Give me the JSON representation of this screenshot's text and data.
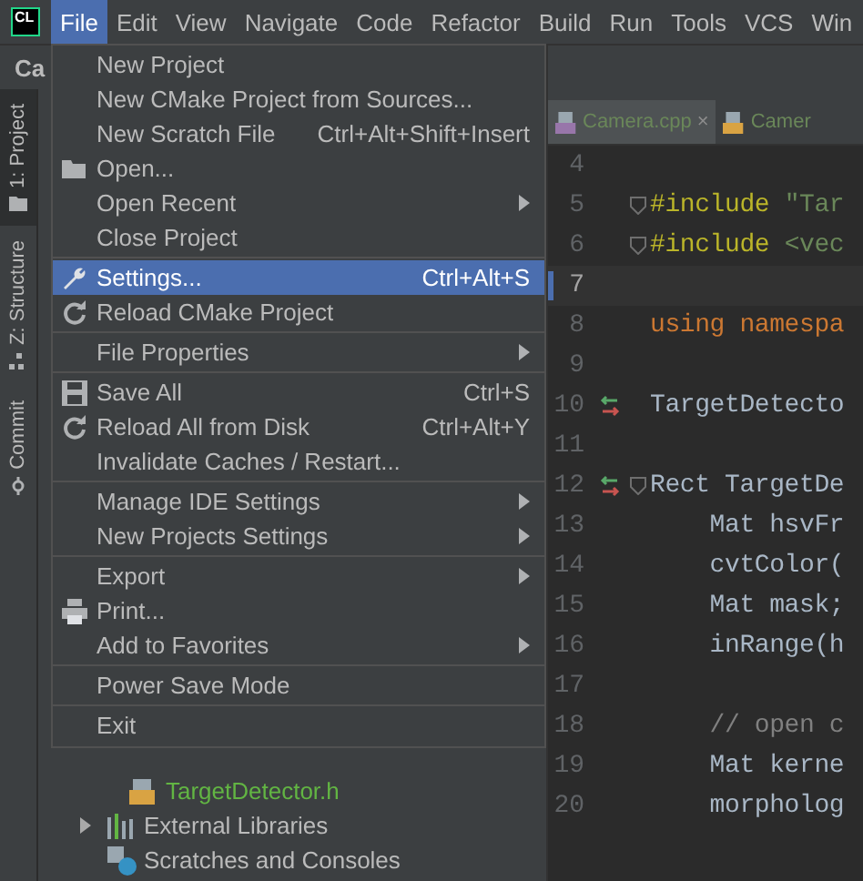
{
  "logo": "CL",
  "menubar": [
    {
      "label": "File",
      "selected": true
    },
    {
      "label": "Edit",
      "selected": false
    },
    {
      "label": "View",
      "selected": false
    },
    {
      "label": "Navigate",
      "selected": false
    },
    {
      "label": "Code",
      "selected": false
    },
    {
      "label": "Refactor",
      "selected": false
    },
    {
      "label": "Build",
      "selected": false
    },
    {
      "label": "Run",
      "selected": false
    },
    {
      "label": "Tools",
      "selected": false
    },
    {
      "label": "VCS",
      "selected": false
    },
    {
      "label": "Win",
      "selected": false
    }
  ],
  "tool_strip": [
    {
      "label": "1: Project",
      "kind": "folder",
      "selected": true
    },
    {
      "label": "Z: Structure",
      "kind": "structure",
      "selected": false
    },
    {
      "label": "Commit",
      "kind": "commit",
      "selected": false
    }
  ],
  "project_panel": {
    "title": "Ca",
    "tree": [
      {
        "label": "TargetDetector.h",
        "kind": "header",
        "modified": true
      },
      {
        "label": "External Libraries",
        "kind": "libraries",
        "modified": false,
        "expandable": true
      },
      {
        "label": "Scratches and Consoles",
        "kind": "scratches",
        "modified": false,
        "expandable": false
      }
    ]
  },
  "editor": {
    "tabs": [
      {
        "label": "Camera.cpp",
        "kind": "cpp",
        "close": "×",
        "selected": true
      },
      {
        "label": "Camer",
        "kind": "h",
        "selected": false
      }
    ],
    "lines": [
      {
        "number": "4",
        "current": false
      },
      {
        "number": "5",
        "current": false,
        "fold": true,
        "tokens": [
          {
            "text": "#include",
            "kind": "preproc"
          },
          {
            "text": " \"Tar",
            "kind": "string"
          }
        ]
      },
      {
        "number": "6",
        "current": false,
        "fold": true,
        "tokens": [
          {
            "text": "#include",
            "kind": "preproc"
          },
          {
            "text": " <vec",
            "kind": "string"
          }
        ]
      },
      {
        "number": "7",
        "current": true
      },
      {
        "number": "8",
        "current": false,
        "tokens": [
          {
            "text": "using namespa",
            "kind": "keyword"
          }
        ]
      },
      {
        "number": "9",
        "current": false
      },
      {
        "number": "10",
        "current": false,
        "override": true,
        "tokens": [
          {
            "text": "TargetDetecto",
            "kind": "plain"
          }
        ]
      },
      {
        "number": "11",
        "current": false
      },
      {
        "number": "12",
        "current": false,
        "override": true,
        "fold": true,
        "tokens": [
          {
            "text": "Rect TargetDe",
            "kind": "plain"
          }
        ]
      },
      {
        "number": "13",
        "current": false,
        "tokens": [
          {
            "text": "    Mat hsvFr",
            "kind": "plain"
          }
        ]
      },
      {
        "number": "14",
        "current": false,
        "tokens": [
          {
            "text": "    cvtColor(",
            "kind": "plain"
          }
        ]
      },
      {
        "number": "15",
        "current": false,
        "tokens": [
          {
            "text": "    Mat mask;",
            "kind": "plain"
          }
        ]
      },
      {
        "number": "16",
        "current": false,
        "tokens": [
          {
            "text": "    inRange(h",
            "kind": "plain"
          }
        ]
      },
      {
        "number": "17",
        "current": false
      },
      {
        "number": "18",
        "current": false,
        "tokens": [
          {
            "text": "    // open c",
            "kind": "comment"
          }
        ]
      },
      {
        "number": "19",
        "current": false,
        "tokens": [
          {
            "text": "    Mat kerne",
            "kind": "plain"
          }
        ]
      },
      {
        "number": "20",
        "current": false,
        "tokens": [
          {
            "text": "    morpholog",
            "kind": "plain"
          }
        ]
      }
    ]
  },
  "file_menu": {
    "groups": [
      [
        {
          "label": "New Project",
          "selected": false
        },
        {
          "label": "New CMake Project from Sources...",
          "selected": false
        },
        {
          "label": "New Scratch File",
          "shortcut": "Ctrl+Alt+Shift+Insert",
          "selected": false
        },
        {
          "label": "Open...",
          "kind": "folder",
          "selected": false
        },
        {
          "label": "Open Recent",
          "submenu": true,
          "selected": false
        },
        {
          "label": "Close Project",
          "selected": false
        }
      ],
      [
        {
          "label": "Settings...",
          "kind": "wrench",
          "shortcut": "Ctrl+Alt+S",
          "selected": true
        },
        {
          "label": "Reload CMake Project",
          "kind": "reload",
          "selected": false
        }
      ],
      [
        {
          "label": "File Properties",
          "submenu": true,
          "selected": false
        }
      ],
      [
        {
          "label": "Save All",
          "kind": "save",
          "shortcut": "Ctrl+S",
          "selected": false
        },
        {
          "label": "Reload All from Disk",
          "kind": "reload",
          "shortcut": "Ctrl+Alt+Y",
          "selected": false
        },
        {
          "label": "Invalidate Caches / Restart...",
          "selected": false
        }
      ],
      [
        {
          "label": "Manage IDE Settings",
          "submenu": true,
          "selected": false
        },
        {
          "label": "New Projects Settings",
          "submenu": true,
          "selected": false
        }
      ],
      [
        {
          "label": "Export",
          "submenu": true,
          "selected": false
        },
        {
          "label": "Print...",
          "kind": "print",
          "selected": false
        },
        {
          "label": "Add to Favorites",
          "submenu": true,
          "selected": false
        }
      ],
      [
        {
          "label": "Power Save Mode",
          "selected": false
        }
      ],
      [
        {
          "label": "Exit",
          "selected": false
        }
      ]
    ]
  }
}
